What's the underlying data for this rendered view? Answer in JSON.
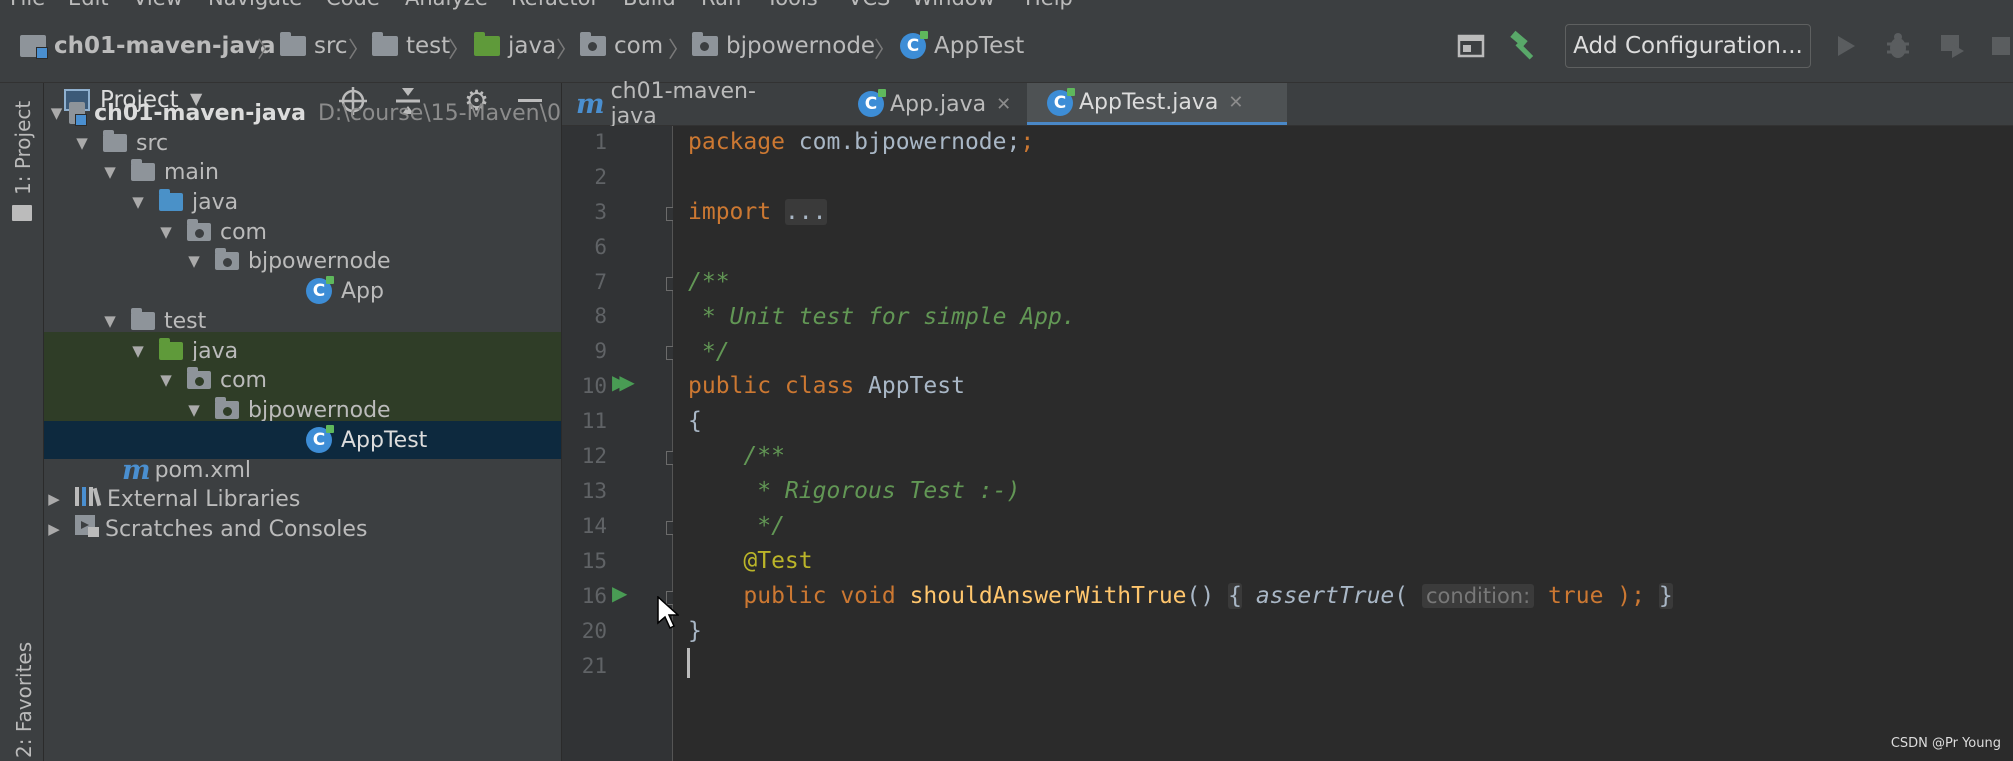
{
  "menu": [
    "File",
    "Edit",
    "View",
    "Navigate",
    "Code",
    "Analyze",
    "Refactor",
    "Build",
    "Run",
    "Tools",
    "VCS",
    "Window",
    "Help"
  ],
  "breadcrumbs": [
    "ch01-maven-java",
    "src",
    "test",
    "java",
    "com",
    "bjpowernode",
    "AppTest"
  ],
  "toolbar": {
    "config_label": "Add Configuration...",
    "icons": [
      "layout-icon",
      "build-hammer-icon",
      "run-icon",
      "debug-icon",
      "coverage-icon",
      "stop-icon"
    ]
  },
  "side_strip": {
    "project_label": "1: Project",
    "favorites_label": "2: Favorites"
  },
  "project_panel": {
    "title": "Project",
    "tree": [
      {
        "label": "ch01-maven-java",
        "path": "D:\\course\\15-Maven\\0"
      },
      {
        "label": "src"
      },
      {
        "label": "main"
      },
      {
        "label": "java"
      },
      {
        "label": "com"
      },
      {
        "label": "bjpowernode"
      },
      {
        "label": "App"
      },
      {
        "label": "test"
      },
      {
        "label": "java"
      },
      {
        "label": "com"
      },
      {
        "label": "bjpowernode"
      },
      {
        "label": "AppTest"
      },
      {
        "label": "pom.xml"
      },
      {
        "label": "External Libraries"
      },
      {
        "label": "Scratches and Consoles"
      }
    ]
  },
  "editor": {
    "tabs": [
      {
        "label": "ch01-maven-java",
        "icon": "maven-icon"
      },
      {
        "label": "App.java",
        "icon": "class-icon"
      },
      {
        "label": "AppTest.java",
        "icon": "class-icon",
        "active": true
      }
    ],
    "line_numbers": [
      "1",
      "2",
      "3",
      "6",
      "7",
      "8",
      "9",
      "10",
      "11",
      "12",
      "13",
      "14",
      "15",
      "16",
      "20",
      "21"
    ],
    "code": {
      "l1_kw": "package",
      "l1_rest": " com.bjpowernode;",
      "l3_kw": "import",
      "l3_fold": "...",
      "l7": "/**",
      "l8": " * Unit test for simple App.",
      "l9": " */",
      "l10_kw": "public class",
      "l10_rest": " AppTest",
      "l11": "{",
      "l12": "    /**",
      "l13": "     * Rigorous Test :-)",
      "l14": "     */",
      "l15": "    @Test",
      "l16_kw": "    public void",
      "l16_fn": "shouldAnswerWithTrue",
      "l16_parens": "()",
      "l16_open": "{",
      "l16_call": "assertTrue",
      "l16_paren_open": "(",
      "l16_hint": "condition:",
      "l16_val": "true",
      "l16_end": " );",
      "l16_close": "}",
      "l20": "}"
    }
  },
  "watermark": "CSDN @Pr Young"
}
